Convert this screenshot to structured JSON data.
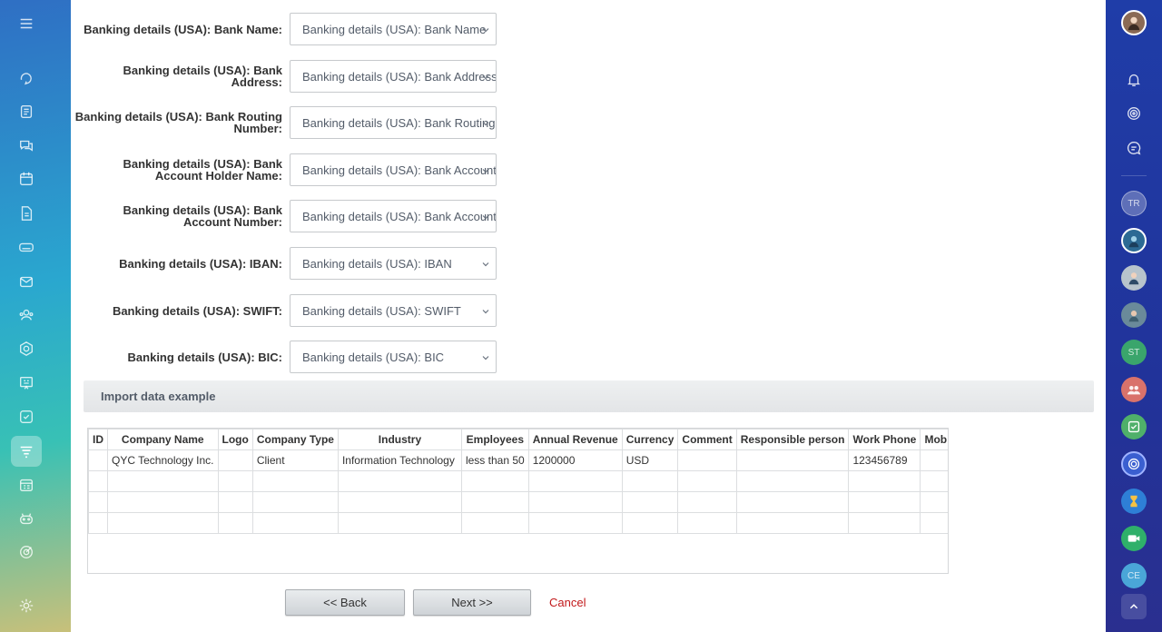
{
  "form_rows": [
    {
      "label": "Banking details (USA): Bank Name:",
      "value": "Banking details (USA): Bank Name"
    },
    {
      "label": "Banking details (USA): Bank Address:",
      "value": "Banking details (USA): Bank Address"
    },
    {
      "label": "Banking details (USA): Bank Routing Number:",
      "value": "Banking details (USA): Bank Routing Number"
    },
    {
      "label": "Banking details (USA): Bank Account Holder Name:",
      "value": "Banking details (USA): Bank Account Holder Name"
    },
    {
      "label": "Banking details (USA): Bank Account Number:",
      "value": "Banking details (USA): Bank Account Number"
    },
    {
      "label": "Banking details (USA): IBAN:",
      "value": "Banking details (USA): IBAN"
    },
    {
      "label": "Banking details (USA): SWIFT:",
      "value": "Banking details (USA): SWIFT"
    },
    {
      "label": "Banking details (USA): BIC:",
      "value": "Banking details (USA): BIC"
    }
  ],
  "example": {
    "title": "Import data example",
    "columns": [
      "ID",
      "Company Name",
      "Logo",
      "Company Type",
      "Industry",
      "Employees",
      "Annual Revenue",
      "Currency",
      "Comment",
      "Responsible person",
      "Work Phone",
      "Mob"
    ],
    "rows": [
      [
        "",
        "QYC Technology Inc.",
        "",
        "Client",
        "Information Technology",
        "less than 50",
        "1200000",
        "USD",
        "",
        "",
        "123456789",
        ""
      ],
      [
        "",
        "",
        "",
        "",
        "",
        "",
        "",
        "",
        "",
        "",
        "",
        ""
      ],
      [
        "",
        "",
        "",
        "",
        "",
        "",
        "",
        "",
        "",
        "",
        "",
        ""
      ],
      [
        "",
        "",
        "",
        "",
        "",
        "",
        "",
        "",
        "",
        "",
        "",
        ""
      ]
    ]
  },
  "buttons": {
    "back": "<< Back",
    "next": "Next >>",
    "cancel": "Cancel"
  },
  "right_sidebar": {
    "avatar_initials_1": "TR",
    "avatar_initials_2": "ST",
    "avatar_initials_3": "CE"
  },
  "left_sidebar_icons": [
    "menu-icon",
    "feed-icon",
    "tasks-icon",
    "chat-icon",
    "calendar-icon",
    "documents-icon",
    "drive-icon",
    "mail-icon",
    "contacts-icon",
    "workgroups-icon",
    "sites-icon",
    "tasks-check-icon",
    "crm-icon",
    "schedule-icon",
    "automation-icon",
    "target-icon",
    "settings-icon"
  ],
  "colors": {
    "cancel": "#c2191b",
    "right_sidebar": "#21339a"
  }
}
